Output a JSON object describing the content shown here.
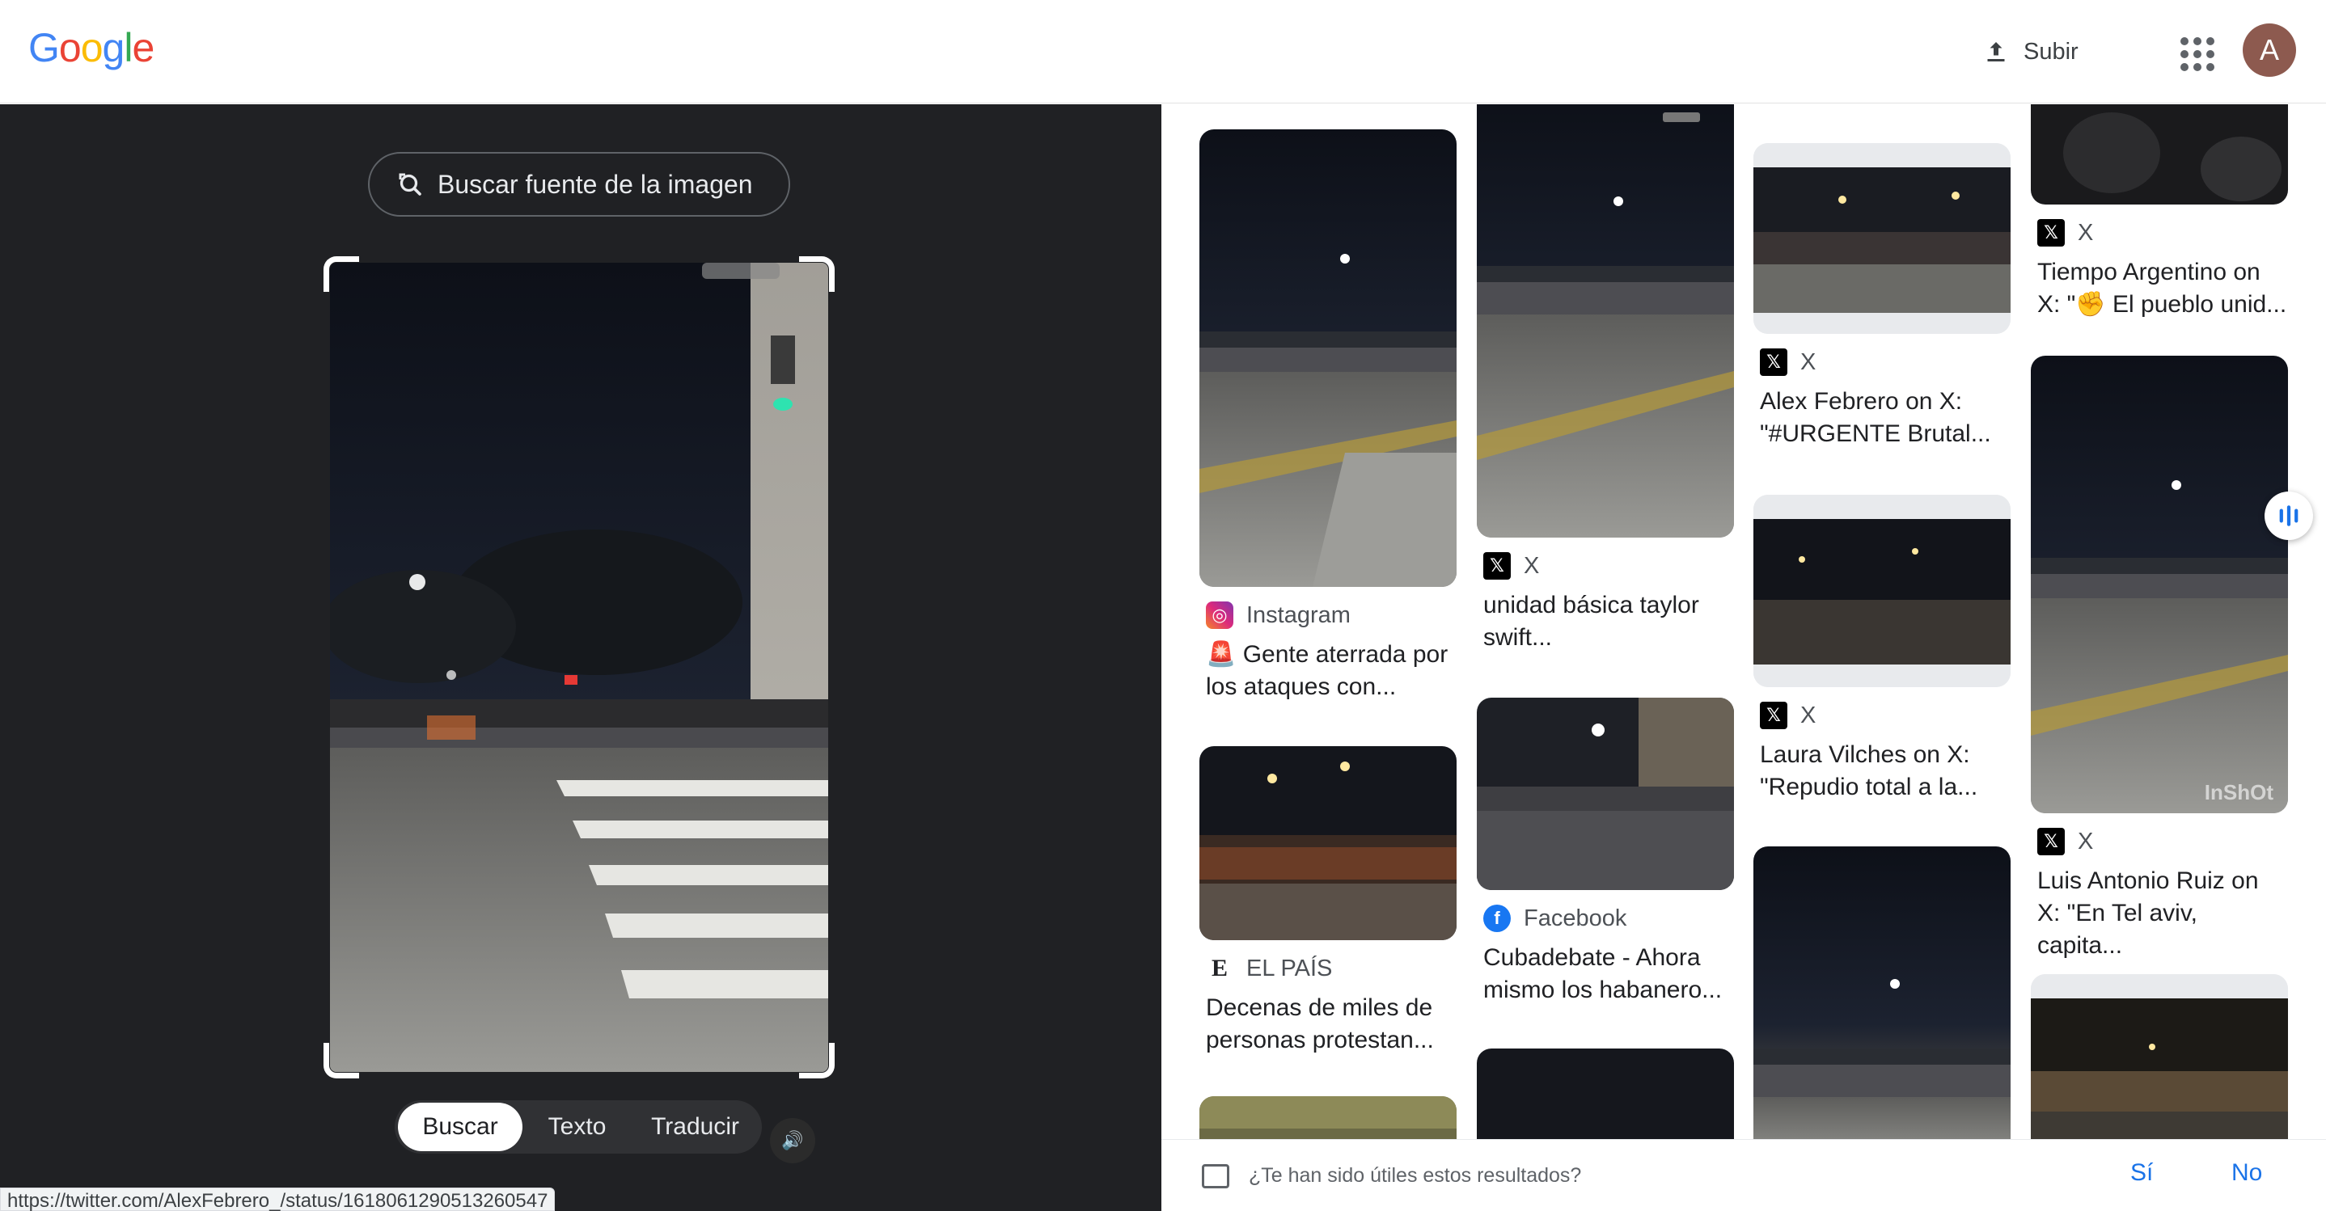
{
  "header": {
    "logo_letters": [
      {
        "ch": "G",
        "color": "#4285f4"
      },
      {
        "ch": "o",
        "color": "#ea4335"
      },
      {
        "ch": "o",
        "color": "#fbbc05"
      },
      {
        "ch": "g",
        "color": "#4285f4"
      },
      {
        "ch": "l",
        "color": "#34a853"
      },
      {
        "ch": "e",
        "color": "#ea4335"
      }
    ],
    "upload_label": "Subir",
    "avatar_letter": "A"
  },
  "lens": {
    "source_button": "Buscar fuente de la imagen",
    "modes": [
      "Buscar",
      "Texto",
      "Traducir"
    ],
    "active_mode": "Buscar"
  },
  "status_url": "https://twitter.com/AlexFebrero_/status/1618061290513260547",
  "results": {
    "col1": [
      {
        "source": "Instagram",
        "icon": "instagram-icon",
        "title_l1": "🚨 Gente aterrada por",
        "title_l2": "los ataques con..."
      },
      {
        "source": "EL PAÍS",
        "icon": "elpais-icon",
        "title_l1": "Decenas de miles de",
        "title_l2": "personas protestan..."
      }
    ],
    "col2": [
      {
        "source": "X",
        "icon": "x-icon",
        "title_l1": "unidad básica taylor",
        "title_l2": "swift..."
      },
      {
        "source": "Facebook",
        "icon": "facebook-icon",
        "title_l1": "Cubadebate - Ahora",
        "title_l2": "mismo los habanero..."
      }
    ],
    "col3": [
      {
        "source": "X",
        "icon": "x-icon",
        "title_l1": "Alex Febrero on X:",
        "title_l2": "\"#URGENTE Brutal..."
      },
      {
        "source": "X",
        "icon": "x-icon",
        "title_l1": "Laura Vilches on X:",
        "title_l2": "\"Repudio total a la..."
      }
    ],
    "col4": [
      {
        "source": "X",
        "icon": "x-icon",
        "title_l1": "Tiempo Argentino on",
        "title_l2": "X: \"✊ El pueblo unid..."
      },
      {
        "source": "X",
        "icon": "x-icon",
        "title_l1": "Luis Antonio Ruiz on",
        "title_l2": "X: \"En Tel aviv, capita..."
      }
    ],
    "watermark": "InShOt"
  },
  "feedback": {
    "question": "¿Te han sido útiles estos resultados?",
    "yes": "Sí",
    "no": "No"
  }
}
